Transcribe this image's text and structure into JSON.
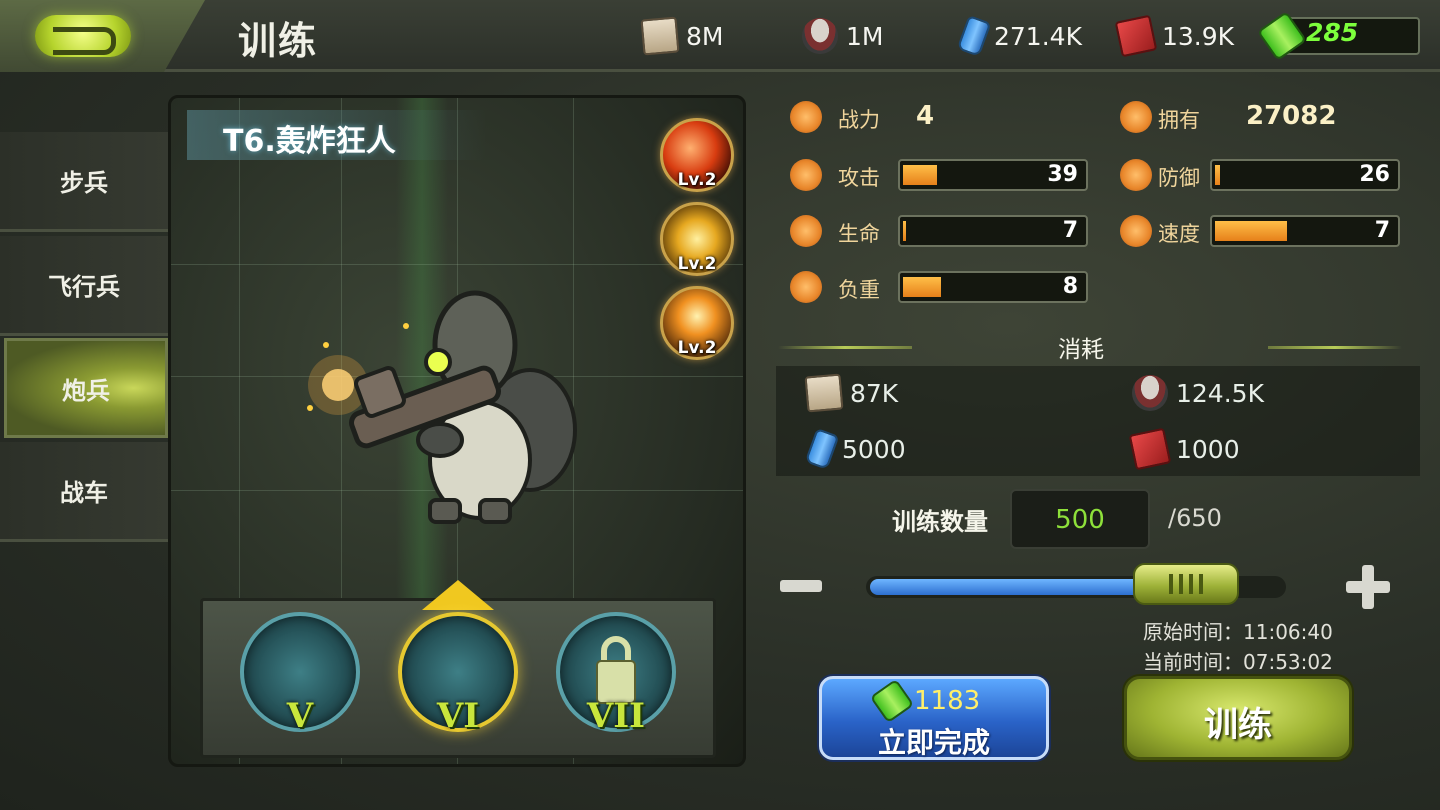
{
  "header": {
    "title": "训练",
    "back_icon": "back-arrow-icon"
  },
  "resources": [
    {
      "icon": "paper-icon",
      "value": "8M"
    },
    {
      "icon": "food-can-icon",
      "value": "1M"
    },
    {
      "icon": "water-bottle-icon",
      "value": "271.4K"
    },
    {
      "icon": "fuel-canister-icon",
      "value": "13.9K"
    },
    {
      "icon": "battery-icon",
      "value": "285"
    }
  ],
  "tabs": [
    {
      "label": "步兵",
      "active": false
    },
    {
      "label": "飞行兵",
      "active": false
    },
    {
      "label": "炮兵",
      "active": true
    },
    {
      "label": "战车",
      "active": false
    }
  ],
  "unit": {
    "name": "T6.轰炸狂人",
    "skills": [
      {
        "icon": "fire-skill-icon",
        "level": "Lv.2"
      },
      {
        "icon": "burst-skill-icon",
        "level": "Lv.2"
      },
      {
        "icon": "lightning-skill-icon",
        "level": "Lv.2"
      }
    ],
    "variants": [
      {
        "numeral": "V",
        "selected": false,
        "locked": false
      },
      {
        "numeral": "VI",
        "selected": true,
        "locked": false
      },
      {
        "numeral": "VII",
        "selected": false,
        "locked": true
      }
    ]
  },
  "stats": {
    "power": {
      "label": "战力",
      "value": "4"
    },
    "owned": {
      "label": "拥有",
      "value": "27082"
    },
    "attack": {
      "label": "攻击",
      "value": "39",
      "fill": 0.19
    },
    "defense": {
      "label": "防御",
      "value": "26",
      "fill": 0.03
    },
    "health": {
      "label": "生命",
      "value": "7",
      "fill": 0.01
    },
    "speed": {
      "label": "速度",
      "value": "7",
      "fill": 0.4
    },
    "load": {
      "label": "负重",
      "value": "8",
      "fill": 0.21
    }
  },
  "cost": {
    "title": "消耗",
    "items": [
      {
        "icon": "paper-icon",
        "value": "87K"
      },
      {
        "icon": "food-can-icon",
        "value": "124.5K"
      },
      {
        "icon": "water-bottle-icon",
        "value": "5000"
      },
      {
        "icon": "fuel-canister-icon",
        "value": "1000"
      }
    ]
  },
  "quantity": {
    "label": "训练数量",
    "value": "500",
    "max": "/650",
    "fraction": 0.77
  },
  "times": {
    "original_label": "原始时间：",
    "original_value": "11:06:40",
    "current_label": "当前时间：",
    "current_value": "07:53:02"
  },
  "buttons": {
    "instant_cost": "1183",
    "instant_label": "立即完成",
    "train_label": "训练"
  }
}
